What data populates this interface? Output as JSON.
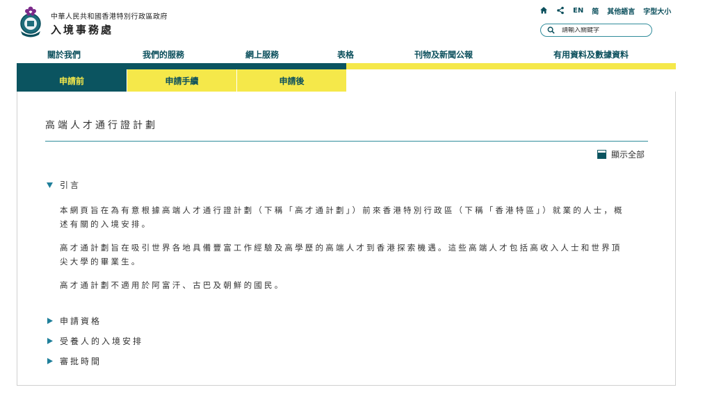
{
  "header": {
    "gov_name": "中華人民共和國香港特別行政區政府",
    "dept_name": "入境事務處",
    "toplinks": {
      "en": "EN",
      "simplified": "简",
      "other_lang": "其他語言",
      "font_size": "字型大小"
    },
    "search": {
      "placeholder": "請輸入關鍵字"
    }
  },
  "nav": {
    "items": [
      "關於我們",
      "我們的服務",
      "網上服務",
      "表格",
      "刊物及新聞公報",
      "有用資料及數據資料"
    ]
  },
  "subtabs": [
    "申請前",
    "申請手續",
    "申請後"
  ],
  "content": {
    "title": "高端人才通行證計劃",
    "show_all": "顯示全部",
    "intro": {
      "heading": "引言",
      "paragraphs": [
        "本網頁旨在為有意根據高端人才通行證計劃（下稱「高才通計劃」）前來香港特別行政區（下稱「香港特區」）就業的人士，概述有關的入境安排。",
        "高才通計劃旨在吸引世界各地具備豐富工作經驗及高學歷的高端人才到香港探索機遇。這些高端人才包括高收入人士和世界頂尖大學的畢業生。",
        "高才通計劃不適用於阿富汗、古巴及朝鮮的國民。"
      ]
    },
    "sections": [
      "申請資格",
      "受養人的入境安排",
      "審批時間"
    ]
  },
  "colors": {
    "dark_teal": "#0b5460",
    "yellow": "#f5e84a",
    "link_teal": "#0b4f5c"
  }
}
